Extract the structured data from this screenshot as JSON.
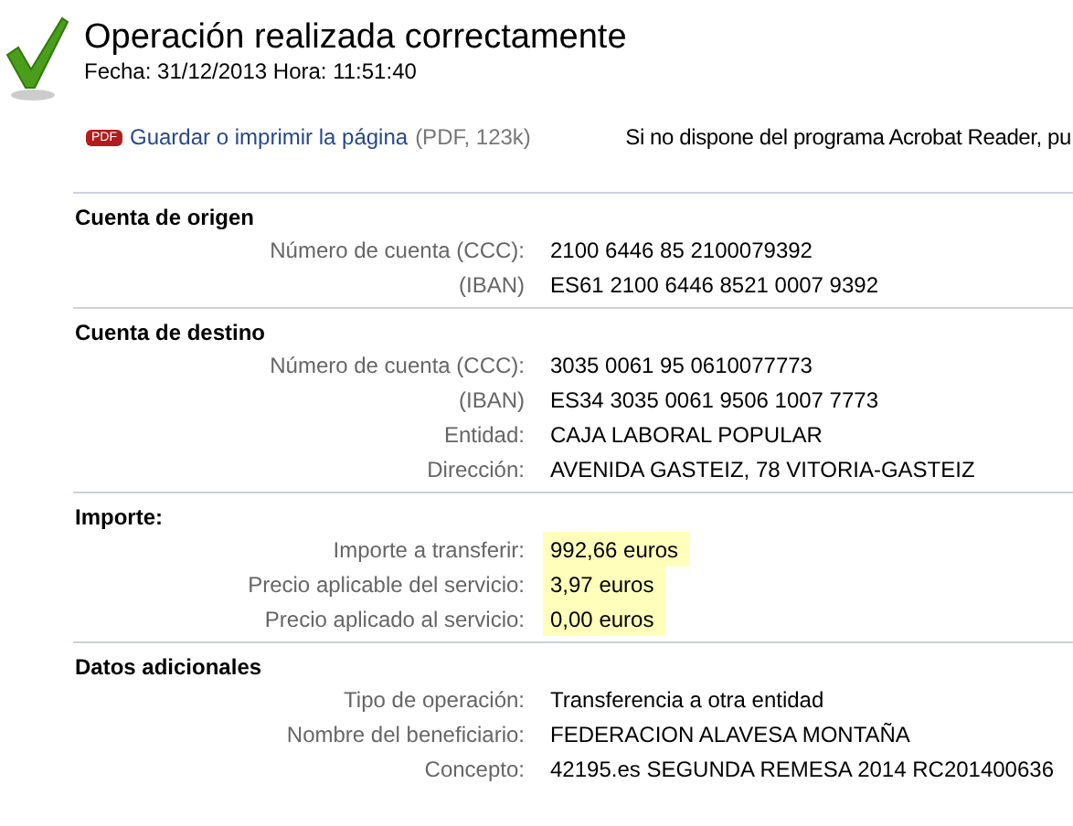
{
  "header": {
    "title": "Operación realizada correctamente",
    "timestamp": "Fecha: 31/12/2013 Hora: 11:51:40"
  },
  "pdf": {
    "badge": "PDF",
    "link": "Guardar o imprimir la página",
    "info": "(PDF, 123k)",
    "note": "Si no dispone del programa Acrobat Reader, pu"
  },
  "sections": [
    {
      "heading": "Cuenta de origen",
      "rows": [
        {
          "label": "Número de cuenta (CCC):",
          "value": "2100 6446 85 2100079392",
          "highlight": false
        },
        {
          "label": "(IBAN)",
          "value": "ES61 2100 6446 8521 0007 9392",
          "highlight": false
        }
      ]
    },
    {
      "heading": "Cuenta de destino",
      "rows": [
        {
          "label": "Número de cuenta (CCC):",
          "value": "3035 0061 95 0610077773",
          "highlight": false
        },
        {
          "label": "(IBAN)",
          "value": "ES34 3035 0061 9506 1007 7773",
          "highlight": false
        },
        {
          "label": "Entidad:",
          "value": "CAJA LABORAL POPULAR",
          "highlight": false
        },
        {
          "label": "Dirección:",
          "value": "AVENIDA GASTEIZ, 78 VITORIA-GASTEIZ",
          "highlight": false
        }
      ]
    },
    {
      "heading": "Importe:",
      "rows": [
        {
          "label": "Importe a transferir:",
          "value": "992,66 euros",
          "highlight": true
        },
        {
          "label": "Precio aplicable del servicio:",
          "value": "3,97 euros",
          "highlight": true
        },
        {
          "label": "Precio aplicado al servicio:",
          "value": "0,00 euros",
          "highlight": true
        }
      ]
    },
    {
      "heading": "Datos adicionales",
      "rows": [
        {
          "label": "Tipo de operación:",
          "value": "Transferencia a otra entidad",
          "highlight": false
        },
        {
          "label": "Nombre del beneficiario:",
          "value": "FEDERACION ALAVESA MONTAÑA",
          "highlight": false
        },
        {
          "label": "Concepto:",
          "value": "42195.es SEGUNDA REMESA 2014 RC201400636",
          "highlight": false
        }
      ]
    }
  ]
}
